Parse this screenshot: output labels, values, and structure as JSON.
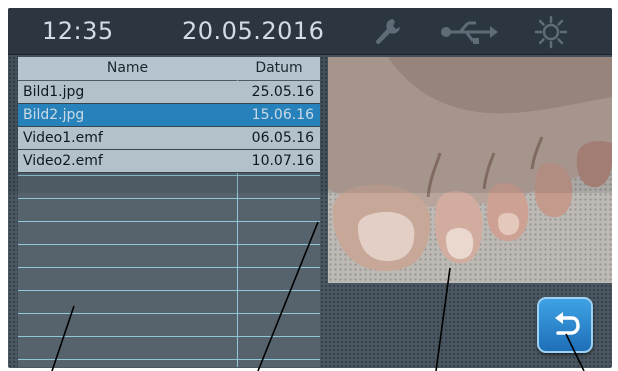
{
  "status_bar": {
    "time": "12:35",
    "date": "20.05.2016",
    "icons": [
      "wrench-icon",
      "usb-icon",
      "sun-icon"
    ]
  },
  "file_table": {
    "headers": {
      "name": "Name",
      "datum": "Datum"
    },
    "rows": [
      {
        "name": "Bild1.jpg",
        "date": "25.05.16",
        "selected": false
      },
      {
        "name": "Bild2.jpg",
        "date": "15.06.16",
        "selected": true
      },
      {
        "name": "Video1.emf",
        "date": "06.05.16",
        "selected": false
      },
      {
        "name": "Video2.emf",
        "date": "10.07.16",
        "selected": false
      }
    ]
  },
  "back_button": {
    "icon": "return-arrow-icon"
  },
  "colors": {
    "accent": "#2b8fcf",
    "panel": "#4a5762",
    "header_bar": "#2b3640"
  }
}
